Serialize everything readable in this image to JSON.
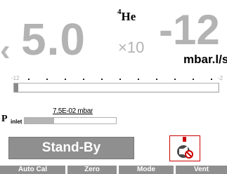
{
  "display": {
    "chevron": "‹",
    "mantissa": "5.0",
    "gas_mass": "4",
    "gas_symbol": "He",
    "multiplier": "×10",
    "exponent": "-12",
    "unit": "mbar.l/s"
  },
  "scale": {
    "left_label": "-12",
    "right_label": "-2",
    "level_fraction": 0.02,
    "tick_count": 11
  },
  "p_inlet": {
    "label_main": "P",
    "label_sub": "inlet",
    "value_text": "7.5E-02 mbar",
    "level_fraction": 0.32
  },
  "status": {
    "text": "Stand-By",
    "icon": "no-sound-icon"
  },
  "softkeys": [
    {
      "label": "Auto Cal"
    },
    {
      "label": "Zero"
    },
    {
      "label": "Mode"
    },
    {
      "label": "Vent"
    }
  ],
  "colors": {
    "value_gray": "#b3b3b3",
    "status_bg": "#8f8f8f",
    "alert_red": "#cc0000"
  }
}
